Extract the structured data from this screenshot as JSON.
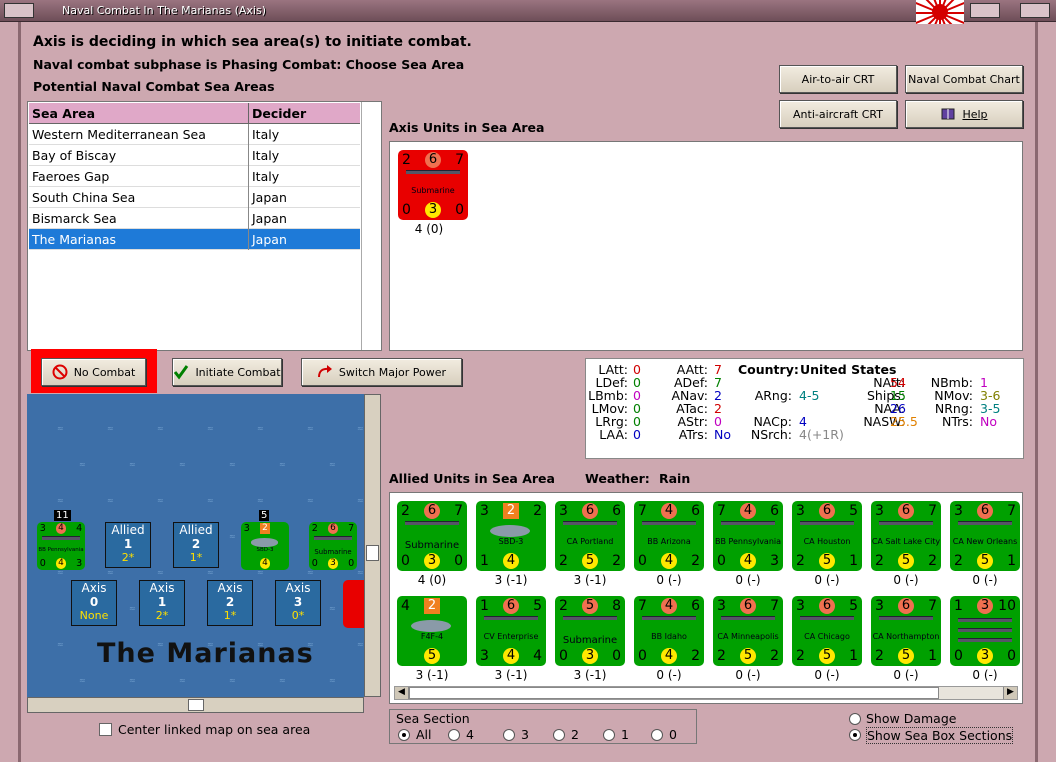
{
  "window": {
    "title": "Naval Combat In The Marianas (Axis)"
  },
  "header": {
    "line1": "Axis is deciding in which sea area(s) to initiate combat.",
    "line2": "Naval combat subphase is Phasing Combat: Choose Sea Area",
    "line3": "Potential Naval Combat Sea Areas"
  },
  "top_buttons": {
    "air_to_air": "Air-to-air CRT",
    "naval_chart": "Naval Combat Chart",
    "anti_aircraft": "Anti-aircraft CRT",
    "help": "Help"
  },
  "sea_table": {
    "headers": [
      "Sea Area",
      "Decider"
    ],
    "rows": [
      {
        "area": "Western Mediterranean Sea",
        "decider": "Italy"
      },
      {
        "area": "Bay of Biscay",
        "decider": "Italy"
      },
      {
        "area": "Faeroes Gap",
        "decider": "Italy"
      },
      {
        "area": "South China Sea",
        "decider": "Japan"
      },
      {
        "area": "Bismarck Sea",
        "decider": "Japan"
      },
      {
        "area": "The Marianas",
        "decider": "Japan"
      }
    ],
    "selected_index": 5
  },
  "action_buttons": {
    "no_combat": "No Combat",
    "initiate": "Initiate Combat",
    "switch": "Switch Major Power"
  },
  "axis_units": {
    "label": "Axis Units in Sea Area",
    "units": [
      {
        "tl": "2",
        "tc": "6",
        "tr": "7",
        "name": "Submarine",
        "bl": "0",
        "bc": "3",
        "br": "0",
        "caption": "4 (0)"
      }
    ]
  },
  "stats": {
    "country_label": "Country:",
    "country": "United States",
    "col1": [
      [
        "LAtt:",
        "0"
      ],
      [
        "LDef:",
        "0"
      ],
      [
        "LBmb:",
        "0"
      ],
      [
        "LMov:",
        "0"
      ],
      [
        "LRrg:",
        "0"
      ],
      [
        "LAA:",
        "0"
      ]
    ],
    "col2": [
      [
        "AAtt:",
        "7"
      ],
      [
        "ADef:",
        "7"
      ],
      [
        "ANav:",
        "2"
      ],
      [
        "ATac:",
        "2"
      ],
      [
        "AStr:",
        "0"
      ],
      [
        "ATrs:",
        "No"
      ]
    ],
    "col3": [
      [
        "ARng:",
        "4-5"
      ],
      [
        "NACp:",
        "4"
      ],
      [
        "NSrch:",
        "4(+1R)"
      ]
    ],
    "col4": [
      [
        "NAtt:",
        "54"
      ],
      [
        "Ships:",
        "15"
      ],
      [
        "NAA:",
        "26"
      ],
      [
        "NASW:",
        "25.5"
      ]
    ],
    "col5": [
      [
        "NBmb:",
        "1"
      ],
      [
        "NMov:",
        "3-6"
      ],
      [
        "NRng:",
        "3-5"
      ],
      [
        "NTrs:",
        "No"
      ]
    ],
    "colors": {
      "LAtt": "#d00000",
      "LDef": "#008000",
      "LBmb": "#c000c0",
      "LMov": "#008000",
      "LRrg": "#008000",
      "LAA": "#0000c0",
      "AAtt": "#d00000",
      "ADef": "#008000",
      "ANav": "#0000c0",
      "ATac": "#d00000",
      "AStr": "#c000c0",
      "ATrs": "#0000c0",
      "ARng": "#008080",
      "NACp": "#0000c0",
      "NSrch": "#888888",
      "NAtt": "#d00000",
      "Ships": "#008000",
      "NAA": "#0000c0",
      "NASW": "#e08000",
      "NBmb": "#c000c0",
      "NMov": "#808000",
      "NRng": "#008080",
      "NTrs": "#c000c0"
    }
  },
  "allied_units": {
    "label": "Allied Units in Sea Area",
    "weather_label": "Weather:",
    "weather": "Rain",
    "row1": [
      {
        "tl": "2",
        "tc": "6",
        "tr": "7",
        "name": "Submarine",
        "bl": "0",
        "bc": "3",
        "br": "0",
        "caption": "4 (0)",
        "kind": "sub"
      },
      {
        "tl": "3",
        "tc": "2",
        "tr": "2",
        "name": "SBD-3",
        "bl": "1",
        "bc": "4",
        "br": "",
        "caption": "3 (-1)",
        "kind": "plane",
        "sq": true
      },
      {
        "tl": "3",
        "tc": "6",
        "tr": "6",
        "name": "CA Portland",
        "bl": "2",
        "bc": "5",
        "br": "2",
        "caption": "3 (-1)",
        "kind": "ship"
      },
      {
        "tl": "7",
        "tc": "4",
        "tr": "6",
        "name": "BB Arizona",
        "bl": "0",
        "bc": "4",
        "br": "2",
        "caption": "0 (-)",
        "kind": "ship"
      },
      {
        "tl": "7",
        "tc": "4",
        "tr": "6",
        "name": "BB Pennsylvania",
        "bl": "0",
        "bc": "4",
        "br": "3",
        "caption": "0 (-)",
        "kind": "ship"
      },
      {
        "tl": "3",
        "tc": "6",
        "tr": "5",
        "name": "CA Houston",
        "bl": "2",
        "bc": "5",
        "br": "1",
        "caption": "0 (-)",
        "kind": "ship"
      },
      {
        "tl": "3",
        "tc": "6",
        "tr": "7",
        "name": "CA Salt Lake City",
        "bl": "2",
        "bc": "5",
        "br": "2",
        "caption": "0 (-)",
        "kind": "ship"
      },
      {
        "tl": "3",
        "tc": "6",
        "tr": "7",
        "name": "CA New Orleans",
        "bl": "2",
        "bc": "5",
        "br": "1",
        "caption": "0 (-)",
        "kind": "ship"
      }
    ],
    "row2": [
      {
        "tl": "4",
        "tc": "2",
        "tr": "",
        "name": "F4F-4",
        "bl": "",
        "bc": "5",
        "br": "",
        "caption": "3 (-1)",
        "kind": "plane",
        "sq": true
      },
      {
        "tl": "1",
        "tc": "6",
        "tr": "5",
        "name": "CV Enterprise",
        "bl": "3",
        "bc": "4",
        "br": "4",
        "caption": "3 (-1)",
        "kind": "ship"
      },
      {
        "tl": "2",
        "tc": "5",
        "tr": "8",
        "name": "Submarine",
        "bl": "0",
        "bc": "3",
        "br": "0",
        "caption": "3 (-1)",
        "kind": "sub"
      },
      {
        "tl": "7",
        "tc": "4",
        "tr": "6",
        "name": "BB Idaho",
        "bl": "0",
        "bc": "4",
        "br": "2",
        "caption": "0 (-)",
        "kind": "ship"
      },
      {
        "tl": "3",
        "tc": "6",
        "tr": "7",
        "name": "CA Minneapolis",
        "bl": "2",
        "bc": "5",
        "br": "2",
        "caption": "0 (-)",
        "kind": "ship"
      },
      {
        "tl": "3",
        "tc": "6",
        "tr": "5",
        "name": "CA Chicago",
        "bl": "2",
        "bc": "5",
        "br": "1",
        "caption": "0 (-)",
        "kind": "ship"
      },
      {
        "tl": "3",
        "tc": "6",
        "tr": "7",
        "name": "CA Northampton",
        "bl": "2",
        "bc": "5",
        "br": "1",
        "caption": "0 (-)",
        "kind": "ship"
      },
      {
        "tl": "1",
        "tc": "3",
        "tr": "10",
        "name": "",
        "bl": "0",
        "bc": "3",
        "br": "0",
        "caption": "0 (-)",
        "kind": "convoy"
      }
    ]
  },
  "map": {
    "title": "The Marianas",
    "allied_boxes": [
      {
        "label": "Allied",
        "value": "1",
        "sub": "2*"
      },
      {
        "label": "Allied",
        "value": "2",
        "sub": "1*"
      }
    ],
    "axis_boxes": [
      {
        "label": "Axis",
        "value": "0",
        "sub": "None"
      },
      {
        "label": "Axis",
        "value": "1",
        "sub": "2*"
      },
      {
        "label": "Axis",
        "value": "2",
        "sub": "1*"
      },
      {
        "label": "Axis",
        "value": "3",
        "sub": "0*"
      }
    ],
    "stack_counts": [
      "11",
      "5"
    ],
    "mini_units": [
      {
        "tl": "3",
        "tc": "4",
        "tr": "4",
        "name": "BB Pennsylvania",
        "bl": "0",
        "bc": "4",
        "br": "3"
      },
      {
        "tl": "3",
        "tc": "2",
        "tr": "",
        "name": "SBD-3",
        "bl": "",
        "bc": "4",
        "br": ""
      },
      {
        "tl": "2",
        "tc": "6",
        "tr": "7",
        "name": "Submarine",
        "bl": "0",
        "bc": "3",
        "br": "0"
      }
    ]
  },
  "center_linked": {
    "label": "Center linked map on sea area",
    "checked": false
  },
  "sea_section": {
    "label": "Sea Section",
    "options": [
      "All",
      "4",
      "3",
      "2",
      "1",
      "0"
    ],
    "selected": "All"
  },
  "view_options": {
    "show_damage": "Show Damage",
    "show_sections": "Show Sea Box Sections",
    "selected": "show_sections"
  }
}
